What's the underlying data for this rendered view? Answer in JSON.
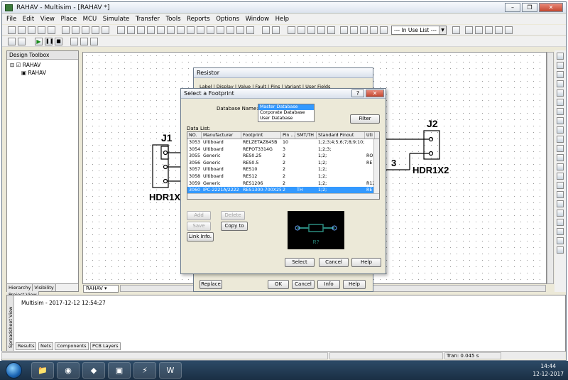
{
  "window": {
    "title": "RAHAV - Multisim - [RAHAV *]"
  },
  "menu": [
    "File",
    "Edit",
    "View",
    "Place",
    "MCU",
    "Simulate",
    "Transfer",
    "Tools",
    "Reports",
    "Options",
    "Window",
    "Help"
  ],
  "toolbar": {
    "in_use_list": "--- In Use List ---"
  },
  "design_toolbox": {
    "title": "Design Toolbox",
    "tree": [
      "RAHAV",
      "RAHAV"
    ],
    "tabs": [
      "Hierarchy",
      "Visibility",
      "Project View"
    ]
  },
  "canvas_tab": "RAHAV",
  "schematic": {
    "j1_ref": "J1",
    "j1_value": "HDR1X",
    "j2_ref": "J2",
    "j2_value": "HDR1X2",
    "net_label": "3"
  },
  "resistor_dialog": {
    "title": "Resistor",
    "tabs": [
      "Label",
      "Display",
      "Value",
      "Fault",
      "Pins",
      "Variant",
      "User Fields"
    ],
    "buttons": {
      "replace": "Replace",
      "ok": "OK",
      "cancel": "Cancel",
      "info": "Info",
      "help": "Help"
    }
  },
  "footprint_dialog": {
    "title": "Select a Footprint",
    "database_label": "Database Name:",
    "databases": [
      "Master Database",
      "Corporate Database",
      "User Database"
    ],
    "filter_button": "Filter",
    "data_list_label": "Data List:",
    "columns": [
      "NO.",
      "Manufacturer",
      "Footprint",
      "Pin ...",
      "SMT/TH",
      "Standard Pinout",
      "Uti"
    ],
    "rows": [
      [
        "3053",
        "Ultiboard",
        "RELZETAZ845B",
        "10",
        "",
        "1;2;3;4;5;6;7;8;9;10;",
        ""
      ],
      [
        "3054",
        "Ultiboard",
        "REPOT3314G",
        "3",
        "",
        "1;2;3;",
        ""
      ],
      [
        "3055",
        "Generic",
        "RES0.25",
        "2",
        "",
        "1;2;",
        "RO"
      ],
      [
        "3056",
        "Generic",
        "RES0.5",
        "2",
        "",
        "1;2;",
        "RE"
      ],
      [
        "3057",
        "Ultiboard",
        "RES10",
        "2",
        "",
        "1;2;",
        ""
      ],
      [
        "3058",
        "Ultiboard",
        "RES12",
        "2",
        "",
        "1;2;",
        ""
      ],
      [
        "3059",
        "Generic",
        "RES1206",
        "2",
        "",
        "1;2;",
        "R12"
      ],
      [
        "3060",
        "IPC-2221A/2222",
        "RES1300-700X250",
        "2",
        "TH",
        "1;2;",
        "RE"
      ]
    ],
    "selected_row": 7,
    "buttons": {
      "add": "Add",
      "delete": "Delete",
      "save": "Save",
      "copy_to": "Copy to",
      "link_info": "Link Info.",
      "select": "Select",
      "cancel": "Cancel",
      "help": "Help"
    },
    "preview_label": "R?"
  },
  "spreadsheet": {
    "side_label": "Spreadsheet View",
    "message": "Multisim  -  2017-12-12 12:54:27",
    "tabs": [
      "Results",
      "Nets",
      "Components",
      "PCB Layers"
    ]
  },
  "status": {
    "tran": "Tran: 0.045 s"
  },
  "taskbar": {
    "time": "14:44",
    "date": "12-12-2017"
  },
  "colors": {
    "selection": "#3399ff",
    "titlebar": "#dbe3ee",
    "taskbar": "#1a2f44"
  }
}
